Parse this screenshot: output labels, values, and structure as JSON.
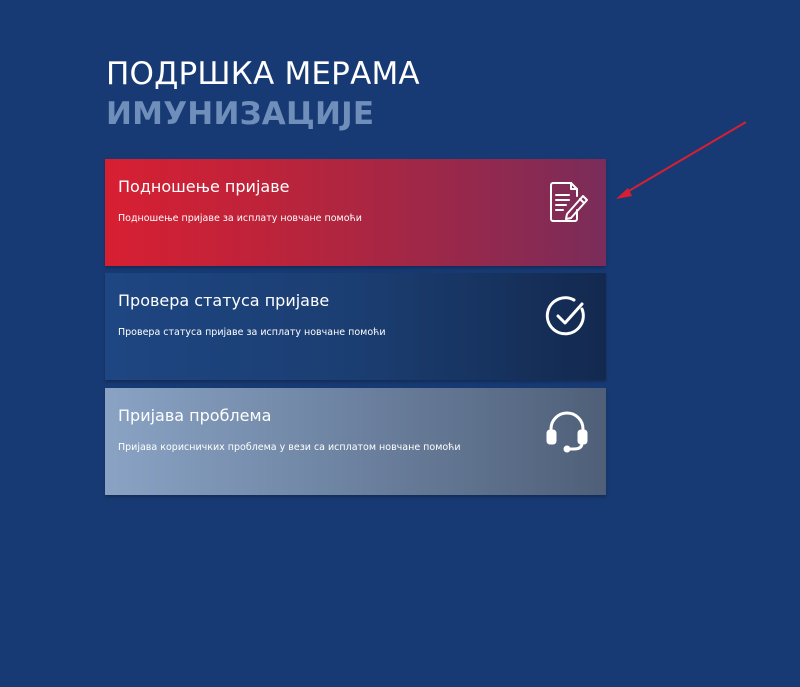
{
  "header": {
    "title_line1": "ПОДРШКА МЕРАМА",
    "title_line2": "ИМУНИЗАЦИЈЕ"
  },
  "cards": [
    {
      "title": "Подношење пријаве",
      "description": "Подношење пријаве за исплату новчане помоћи",
      "icon": "document-edit-icon"
    },
    {
      "title": "Провера статуса пријаве",
      "description": "Провера статуса пријаве за исплату новчане помоћи",
      "icon": "check-circle-icon"
    },
    {
      "title": "Пријава проблема",
      "description": "Пријава корисничких проблема у вези са исплатом новчане помоћи",
      "icon": "headset-icon"
    }
  ],
  "colors": {
    "background": "#183a74",
    "title_accent": "#6f8fba",
    "card1_start": "#d81f32",
    "card1_end": "#7a2c5a",
    "card2_start": "#1e4682",
    "card2_end": "#13294f",
    "card3_start": "#8aa3c4",
    "card3_end": "#4f5f78",
    "annotation_arrow": "#d81f32"
  }
}
